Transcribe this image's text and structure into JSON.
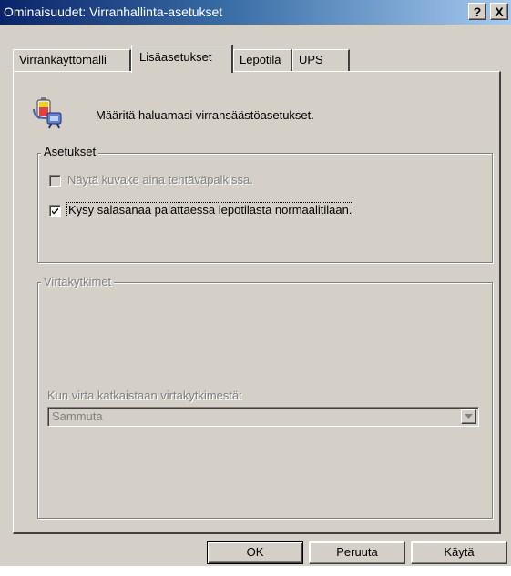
{
  "window": {
    "title": "Ominaisuudet: Virranhallinta-asetukset",
    "help_label": "?",
    "close_label": "X"
  },
  "tabs": [
    {
      "label": "Virrankäyttömalli",
      "active": false
    },
    {
      "label": "Lisäasetukset",
      "active": true
    },
    {
      "label": "Lepotila",
      "active": false
    },
    {
      "label": "UPS",
      "active": false
    }
  ],
  "header": {
    "icon": "power-settings-icon",
    "text": "Määritä haluamasi virransäästöasetukset."
  },
  "settings_group": {
    "legend": "Asetukset",
    "checkbox1": {
      "label": "Näytä kuvake aina tehtäväpalkissa.",
      "checked": false,
      "enabled": false
    },
    "checkbox2": {
      "label": "Kysy salasanaa palattaessa lepotilasta normaalitilaan.",
      "checked": true,
      "enabled": true
    }
  },
  "power_buttons_group": {
    "legend": "Virtakytkimet",
    "combo_label": "Kun virta katkaistaan virtakytkimestä:",
    "combo_value": "Sammuta"
  },
  "buttons": {
    "ok": "OK",
    "cancel": "Peruuta",
    "apply": "Käytä"
  },
  "colors": {
    "titlebar_start": "#0a246a",
    "titlebar_end": "#a6caf0",
    "face": "#d4d0c8"
  }
}
